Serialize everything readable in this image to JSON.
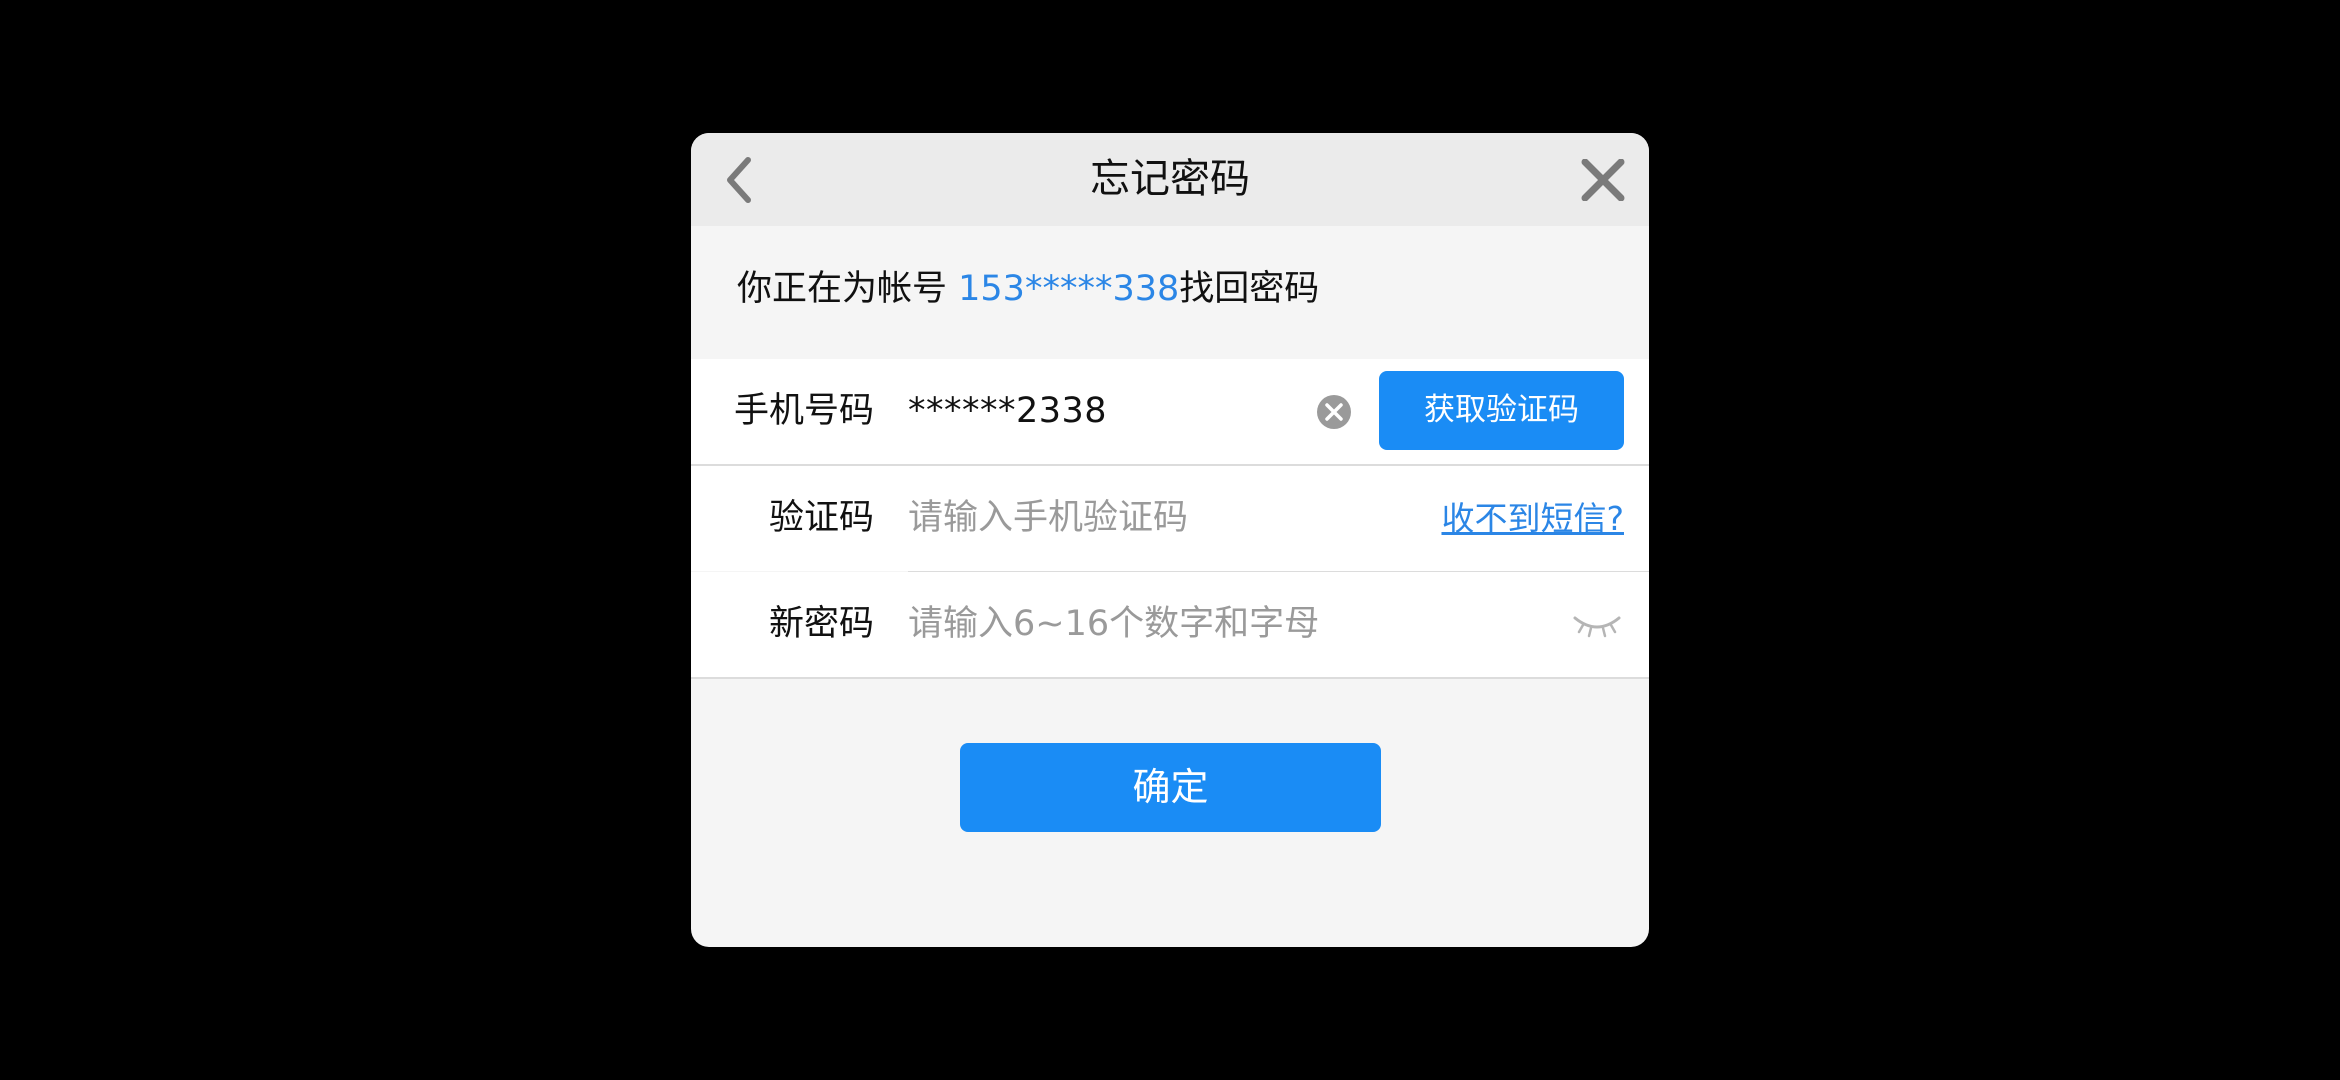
{
  "dialog": {
    "title": "忘记密码",
    "back_icon": "chevron-left-icon",
    "close_icon": "close-icon"
  },
  "account": {
    "prefix": "你正在为帐号 ",
    "masked_account": "153*****338",
    "suffix": "找回密码"
  },
  "form": {
    "phone": {
      "label": "手机号码",
      "value": "******2338",
      "clear_icon": "clear-circle-icon",
      "get_code_label": "获取验证码"
    },
    "code": {
      "label": "验证码",
      "placeholder": "请输入手机验证码",
      "link_label": "收不到短信?"
    },
    "password": {
      "label": "新密码",
      "placeholder": "请输入6~16个数字和字母",
      "toggle_icon": "eye-closed-icon"
    }
  },
  "confirm_label": "确定",
  "colors": {
    "accent": "#1a8cf5",
    "link": "#2b86e6",
    "titlebar": "#ebebeb",
    "panel": "#f5f5f5"
  }
}
